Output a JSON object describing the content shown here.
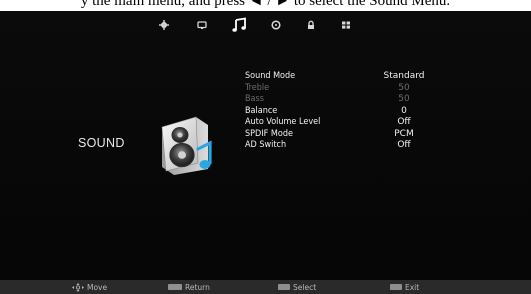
{
  "caption": {
    "text": "y the main menu, and press ◄ / ► to select the Sound Menu."
  },
  "tabs": [
    {
      "name": "settings-gear-icon"
    },
    {
      "name": "picture-icon"
    },
    {
      "name": "sound-note-icon",
      "active": true
    },
    {
      "name": "time-clock-icon"
    },
    {
      "name": "lock-icon"
    },
    {
      "name": "apps-grid-icon"
    }
  ],
  "section": {
    "title": "SOUND"
  },
  "menu": {
    "rows": [
      {
        "label": "Sound Mode",
        "value": "Standard",
        "enabled": true
      },
      {
        "label": "Treble",
        "value": "50",
        "enabled": false
      },
      {
        "label": "Bass",
        "value": "50",
        "enabled": false
      },
      {
        "label": "Balance",
        "value": "0",
        "enabled": true
      },
      {
        "label": "Auto Volume Level",
        "value": "Off",
        "enabled": true
      },
      {
        "label": "SPDIF Mode",
        "value": "PCM",
        "enabled": true
      },
      {
        "label": "AD Switch",
        "value": "Off",
        "enabled": true
      }
    ]
  },
  "hints": {
    "move": "Move",
    "return": "Return",
    "select": "Select",
    "exit": "Exit"
  },
  "colors": {
    "screen": "#0b0b0b",
    "hintbar": "#2a2a2a",
    "accent": "#2aa7e0"
  }
}
